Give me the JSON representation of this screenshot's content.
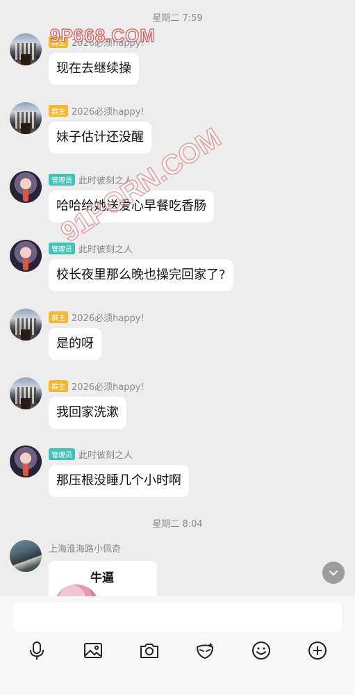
{
  "chat": {
    "time_separators": [
      "星期二 7:59",
      "星期二 8:04"
    ],
    "roles": {
      "owner": "群主",
      "admin": "管理员"
    },
    "messages": [
      {
        "sender": "2026必须happy!",
        "role": "owner",
        "avatar": "building-avatar",
        "text": "现在去继续操"
      },
      {
        "sender": "2026必须happy!",
        "role": "owner",
        "avatar": "building-avatar",
        "text": "妹子估计还没醒"
      },
      {
        "sender": "此时彼刻之人",
        "role": "admin",
        "avatar": "anime-avatar",
        "text": "哈哈给她送爱心早餐吃香肠"
      },
      {
        "sender": "此时彼刻之人",
        "role": "admin",
        "avatar": "anime-avatar",
        "text": "校长夜里那么晚也操完回家了?"
      },
      {
        "sender": "2026必须happy!",
        "role": "owner",
        "avatar": "building-avatar",
        "text": "是的呀"
      },
      {
        "sender": "2026必须happy!",
        "role": "owner",
        "avatar": "building-avatar",
        "text": "我回家洗漱"
      },
      {
        "sender": "此时彼刻之人",
        "role": "admin",
        "avatar": "anime-avatar",
        "text": "那压根没睡几个小时啊"
      },
      {
        "sender": "上海淮海路小佩奇",
        "role": "",
        "avatar": "road-avatar",
        "sticker_text": "牛逼"
      }
    ],
    "watermarks": [
      "9P668.COM",
      "91PORN.COM"
    ]
  },
  "composer": {
    "input_value": "",
    "tools": [
      "microphone-icon",
      "image-icon",
      "camera-icon",
      "mask-icon",
      "emoji-icon",
      "plus-icon"
    ]
  },
  "colors": {
    "owner_tag": "#f5b830",
    "admin_tag": "#3fc3b4",
    "bubble": "#ffffff",
    "background": "#ededed",
    "watermark": "#e2575b"
  }
}
